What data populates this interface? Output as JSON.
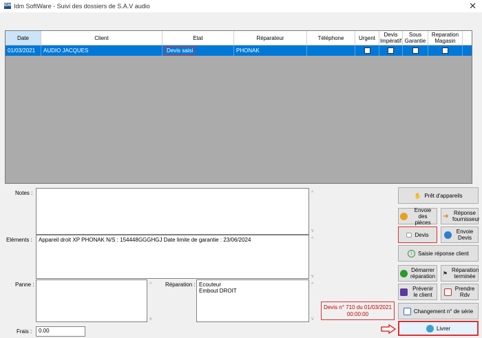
{
  "window": {
    "app_icon_text": "IDM",
    "title": "Idm SoftWare - Suivi des dossiers de S.A.V audio",
    "close_glyph": "✕"
  },
  "grid": {
    "columns": [
      "Date",
      "Client",
      "Etat",
      "Réparateur",
      "Téléphone",
      "Urgent",
      "Devis Impératif",
      "Sous Garantie",
      "Reparation Magasin"
    ],
    "row": {
      "date": "01/03/2021",
      "client": "AUDIO JACQUES",
      "etat": "Devis saisi",
      "reparateur": "PHONAK",
      "telephone": ""
    }
  },
  "form": {
    "notes_label": "Notes :",
    "elements_label": "Eléments :",
    "elements_value": "Appareil droit XP PHONAK N/S : 154448GGGHGJ  Date limite de garantie : 23/06/2024",
    "panne_label": "Panne :",
    "reparation_label": "Réparation :",
    "reparation_line1": "Ecouteur",
    "reparation_line2": "Embout DROIT",
    "frais_label": "Frais :",
    "frais_value": "0.00"
  },
  "buttons": {
    "pret": "Prêt d'appareils",
    "envoie_pieces": "Envoie des pièces",
    "reponse_fournisseur": "Réponse fournisseur",
    "devis": "Devis",
    "envoie_devis": "Envoie Devis",
    "saisie_reponse": "Saisie réponse client",
    "demarrer": "Démarrer réparation",
    "reparation_terminee": "Réparation terminée",
    "prevenir": "Prévenir le client",
    "prendre_rdv": "Prendre Rdv",
    "changement_serie": "Changement n° de série",
    "livrer": "Livrer"
  },
  "devis_note": {
    "line1": "Devis n° 710 du 01/03/2021",
    "line2": "00:00:00"
  }
}
